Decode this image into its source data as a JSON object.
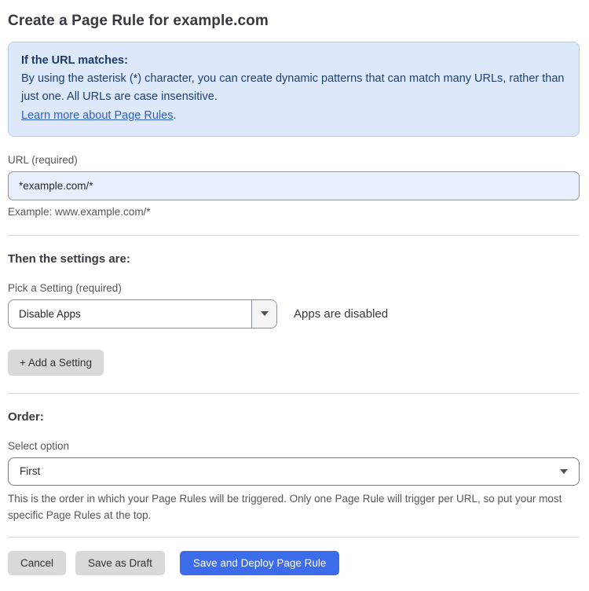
{
  "page": {
    "title": "Create a Page Rule for example.com"
  },
  "info_box": {
    "heading": "If the URL matches:",
    "body": "By using the asterisk (*) character, you can create dynamic patterns that can match many URLs, rather than just one. All URLs are case insensitive.",
    "link_label": "Learn more about Page Rules",
    "link_suffix": "."
  },
  "url_field": {
    "label": "URL (required)",
    "value": "*example.com/*",
    "helper": "Example: www.example.com/*"
  },
  "settings_section": {
    "heading": "Then the settings are:",
    "picker_label": "Pick a Setting (required)",
    "picker_value": "Disable Apps",
    "picker_status": "Apps are disabled",
    "add_setting_label": "+ Add a Setting"
  },
  "order_section": {
    "heading": "Order:",
    "select_label": "Select option",
    "select_value": "First",
    "helper": "This is the order in which your Page Rules will be triggered. Only one Page Rule will trigger per URL, so put your most specific Page Rules at the top."
  },
  "actions": {
    "cancel_label": "Cancel",
    "save_draft_label": "Save as Draft",
    "save_deploy_label": "Save and Deploy Page Rule"
  },
  "colors": {
    "info_background": "#dde9fb",
    "info_border": "#b2ccf1",
    "info_text": "#20406f",
    "link_blue": "#2f5fc4",
    "input_background": "#e9effc",
    "primary_button_blue": "#3c6cea",
    "secondary_button_gray": "#d9d9d9"
  }
}
